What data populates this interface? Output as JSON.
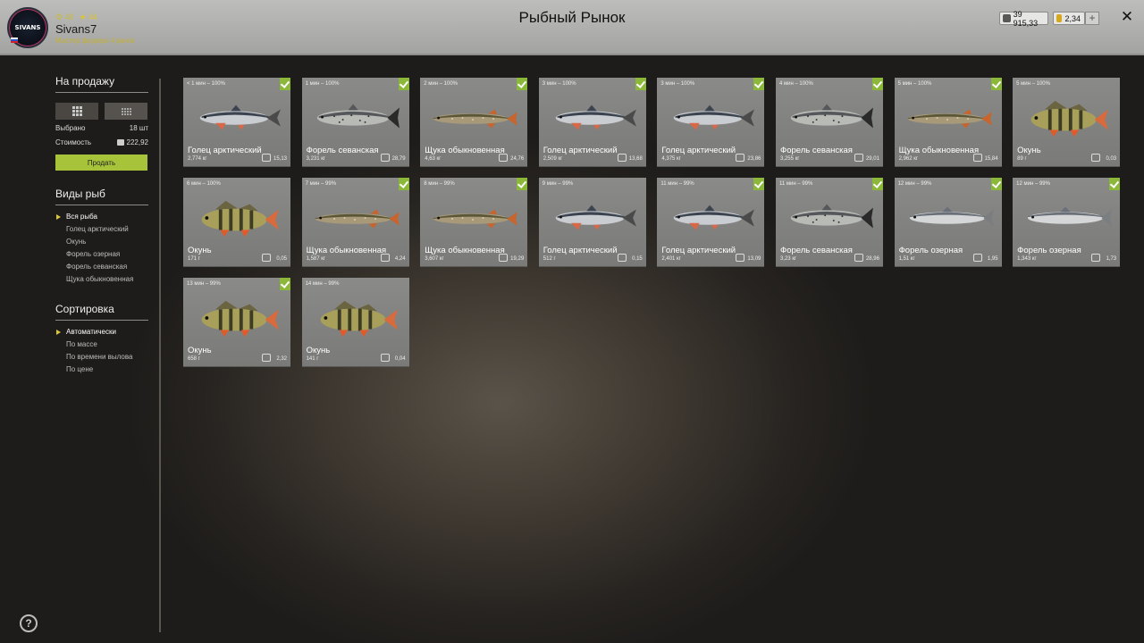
{
  "header": {
    "title": "Рыбный Рынок",
    "avatar_text": "SIVANS",
    "stat_level": "40",
    "stat_rank": "44",
    "username": "Sivans7",
    "rank_text": "Мастер фидера 4 ранга",
    "silver": "39 915,33",
    "gold": "2,34",
    "plus_label": "+",
    "close_label": "✕"
  },
  "sidebar": {
    "for_sale_title": "На продажу",
    "selected_label": "Выбрано",
    "selected_value": "18 шт",
    "cost_label": "Стоимость",
    "cost_value": "222,92",
    "sell_label": "Продать",
    "fish_types_title": "Виды рыб",
    "fish_types": [
      "Вся рыба",
      "Голец арктический",
      "Окунь",
      "Форель озерная",
      "Форель севанская",
      "Щука обыкновенная"
    ],
    "sort_title": "Сортировка",
    "sort_options": [
      "Автоматически",
      "По массе",
      "По времени вылова",
      "По цене"
    ]
  },
  "help_label": "?",
  "colors": {
    "accent": "#a7c33a",
    "check": "#8cb83a",
    "highlight": "#d8c837"
  },
  "fish": [
    {
      "time": "< 1 мин – 100%",
      "name": "Голец арктический",
      "weight": "2,774 кг",
      "price": "15,13",
      "checked": true,
      "kind": "char"
    },
    {
      "time": "1 мин – 100%",
      "name": "Форель севанская",
      "weight": "3,231 кг",
      "price": "28,79",
      "checked": true,
      "kind": "trout"
    },
    {
      "time": "2 мин – 100%",
      "name": "Щука обыкновенная",
      "weight": "4,63 кг",
      "price": "24,76",
      "checked": true,
      "kind": "pike"
    },
    {
      "time": "3 мин – 100%",
      "name": "Голец арктический",
      "weight": "2,509 кг",
      "price": "13,68",
      "checked": true,
      "kind": "char"
    },
    {
      "time": "3 мин – 100%",
      "name": "Голец арктический",
      "weight": "4,375 кг",
      "price": "23,86",
      "checked": true,
      "kind": "char"
    },
    {
      "time": "4 мин – 100%",
      "name": "Форель севанская",
      "weight": "3,255 кг",
      "price": "29,01",
      "checked": true,
      "kind": "trout"
    },
    {
      "time": "5 мин – 100%",
      "name": "Щука обыкновенная",
      "weight": "2,962 кг",
      "price": "15,84",
      "checked": true,
      "kind": "pike"
    },
    {
      "time": "5 мин – 100%",
      "name": "Окунь",
      "weight": "89 г",
      "price": "0,03",
      "checked": false,
      "kind": "perch"
    },
    {
      "time": "6 мин – 100%",
      "name": "Окунь",
      "weight": "171 г",
      "price": "0,05",
      "checked": false,
      "kind": "perch"
    },
    {
      "time": "7 мин – 99%",
      "name": "Щука обыкновенная",
      "weight": "1,587 кг",
      "price": "4,24",
      "checked": true,
      "kind": "pike"
    },
    {
      "time": "8 мин – 99%",
      "name": "Щука обыкновенная",
      "weight": "3,607 кг",
      "price": "19,29",
      "checked": true,
      "kind": "pike"
    },
    {
      "time": "9 мин – 99%",
      "name": "Голец арктический",
      "weight": "512 г",
      "price": "0,15",
      "checked": false,
      "kind": "char"
    },
    {
      "time": "11 мин – 99%",
      "name": "Голец арктический",
      "weight": "2,401 кг",
      "price": "13,09",
      "checked": true,
      "kind": "char"
    },
    {
      "time": "11 мин – 99%",
      "name": "Форель севанская",
      "weight": "3,23 кг",
      "price": "28,96",
      "checked": true,
      "kind": "trout"
    },
    {
      "time": "12 мин – 99%",
      "name": "Форель озерная",
      "weight": "1,51 кг",
      "price": "1,95",
      "checked": true,
      "kind": "lake"
    },
    {
      "time": "12 мин – 99%",
      "name": "Форель озерная",
      "weight": "1,343 кг",
      "price": "1,73",
      "checked": true,
      "kind": "lake"
    },
    {
      "time": "13 мин – 99%",
      "name": "Окунь",
      "weight": "658 г",
      "price": "2,32",
      "checked": true,
      "kind": "perch"
    },
    {
      "time": "14 мин – 99%",
      "name": "Окунь",
      "weight": "141 г",
      "price": "0,04",
      "checked": false,
      "kind": "perch"
    }
  ]
}
